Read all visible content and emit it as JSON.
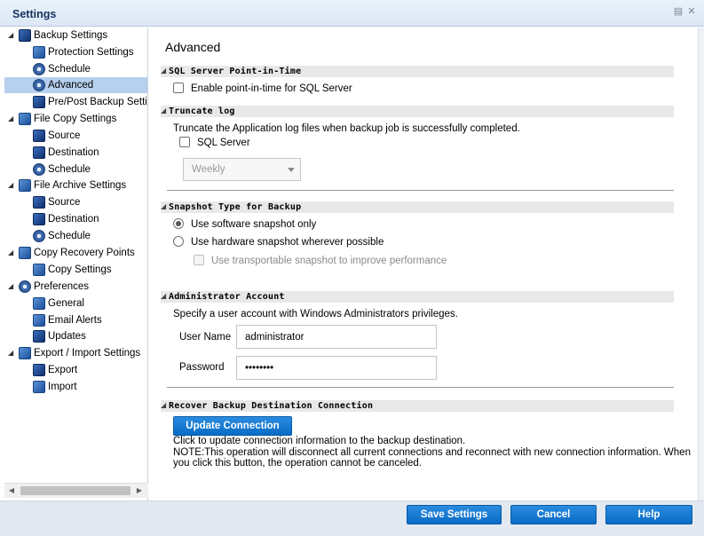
{
  "window": {
    "title": "Settings"
  },
  "tree": {
    "items": [
      {
        "label": "Backup Settings",
        "level": 0,
        "icon": "backup-icon"
      },
      {
        "label": "Protection Settings",
        "level": 1,
        "icon": "protection-icon"
      },
      {
        "label": "Schedule",
        "level": 1,
        "icon": "schedule-icon"
      },
      {
        "label": "Advanced",
        "level": 1,
        "icon": "advanced-icon",
        "selected": true
      },
      {
        "label": "Pre/Post Backup Settings",
        "level": 1,
        "icon": "prepost-icon"
      },
      {
        "label": "File Copy Settings",
        "level": 0,
        "icon": "file-copy-icon"
      },
      {
        "label": "Source",
        "level": 1,
        "icon": "source-icon"
      },
      {
        "label": "Destination",
        "level": 1,
        "icon": "destination-icon"
      },
      {
        "label": "Schedule",
        "level": 1,
        "icon": "schedule-icon"
      },
      {
        "label": "File Archive Settings",
        "level": 0,
        "icon": "file-archive-icon"
      },
      {
        "label": "Source",
        "level": 1,
        "icon": "source-icon"
      },
      {
        "label": "Destination",
        "level": 1,
        "icon": "destination-icon"
      },
      {
        "label": "Schedule",
        "level": 1,
        "icon": "schedule-icon"
      },
      {
        "label": "Copy Recovery Points",
        "level": 0,
        "icon": "copy-recovery-icon"
      },
      {
        "label": "Copy Settings",
        "level": 1,
        "icon": "copy-settings-icon"
      },
      {
        "label": "Preferences",
        "level": 0,
        "icon": "preferences-icon"
      },
      {
        "label": "General",
        "level": 1,
        "icon": "general-icon"
      },
      {
        "label": "Email Alerts",
        "level": 1,
        "icon": "email-icon"
      },
      {
        "label": "Updates",
        "level": 1,
        "icon": "updates-icon"
      },
      {
        "label": "Export / Import Settings",
        "level": 0,
        "icon": "export-import-icon"
      },
      {
        "label": "Export",
        "level": 1,
        "icon": "export-icon"
      },
      {
        "label": "Import",
        "level": 1,
        "icon": "import-icon"
      }
    ]
  },
  "main": {
    "title": "Advanced",
    "sql_pit": {
      "header": "SQL Server Point-in-Time",
      "checkbox_label": "Enable point-in-time for SQL Server"
    },
    "truncate": {
      "header": "Truncate log",
      "description": "Truncate the Application log files when backup job is successfully completed.",
      "checkbox_label": "SQL Server",
      "frequency": "Weekly"
    },
    "snapshot": {
      "header": "Snapshot Type for Backup",
      "option_software": "Use software snapshot only",
      "option_hardware": "Use hardware snapshot wherever possible",
      "transportable_label": "Use transportable snapshot to improve performance"
    },
    "admin": {
      "header": "Administrator Account",
      "description": "Specify a user account with Windows Administrators privileges.",
      "username_label": "User Name",
      "username_value": "administrator",
      "password_label": "Password",
      "password_value": "••••••••"
    },
    "recover": {
      "header": "Recover Backup Destination Connection",
      "button": "Update Connection",
      "line1": "Click to update connection information to the backup destination.",
      "line2": "NOTE:This operation will disconnect all current connections and reconnect with new connection information. When",
      "line3": "you click this button, the operation cannot be canceled."
    }
  },
  "footer": {
    "save": "Save Settings",
    "cancel": "Cancel",
    "help": "Help"
  },
  "colors": {
    "accent": "#0a6bc5",
    "selected": "#b6d0ee"
  }
}
